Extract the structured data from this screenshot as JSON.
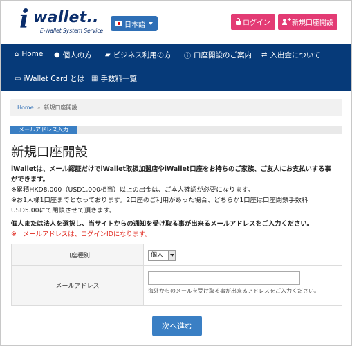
{
  "header": {
    "logo_i": "i",
    "logo_word": "wallet..",
    "logo_sub": "E-Wallet System Service",
    "lang_label": "日本語",
    "login_label": "ログイン",
    "signup_label": "新規口座開設"
  },
  "nav": {
    "items": [
      {
        "label": "Home",
        "icon": "home-icon"
      },
      {
        "label": "個人の方",
        "icon": "user-icon"
      },
      {
        "label": "ビジネス利用の方",
        "icon": "briefcase-icon"
      },
      {
        "label": "口座開設のご案内",
        "icon": "info-icon"
      },
      {
        "label": "入出金について",
        "icon": "exchange-icon"
      },
      {
        "label": "iWallet Card とは",
        "icon": "card-icon"
      },
      {
        "label": "手数料一覧",
        "icon": "calculator-icon"
      }
    ]
  },
  "breadcrumb": {
    "home": "Home",
    "sep": "»",
    "current": "新規口座開設"
  },
  "step": {
    "label": "メールアドレス入力"
  },
  "page": {
    "title": "新規口座開設",
    "intro_bold_1": "iWalletは、メール認証だけでiWallet取扱加盟店やiWallet口座をお持ちのご家族、ご友人にお支払いする事",
    "intro_bold_2": "ができます。",
    "intro_line_3": "※累積HKD8,000（USD1,000相当）以上の出金は、ご本人確認が必要になります。",
    "intro_line_4": "※お1人様1口座までとなっております。2口座のご利用があった場合、どちらか1口座は口座閉鎖手数料",
    "intro_line_5": "USD5.00にて閉鎖させて頂きます。",
    "lead": "個人または法人を選択し、当サイトからの通知を受け取る事が出来るメールアドレスをご入力ください。",
    "warn": "※　メールアドレスは、ログインIDになります。"
  },
  "form": {
    "account_type_label": "口座種別",
    "account_type_value": "個人",
    "email_label": "メールアドレス",
    "email_value": "",
    "email_help": "海外からのメールを受け取る事が出来るアドレスをご入力ください。",
    "next_label": "次へ進む"
  },
  "colors": {
    "nav_bg": "#063a79",
    "accent_pink": "#e33b74",
    "button_blue": "#3a7fc4",
    "warn_red": "#e0281e"
  }
}
